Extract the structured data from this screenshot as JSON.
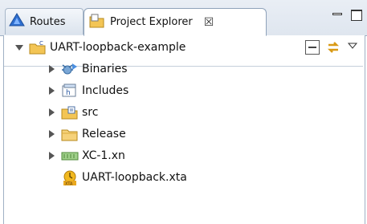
{
  "tabs": [
    {
      "label": "Routes"
    },
    {
      "label": "Project Explorer",
      "close": "☒"
    }
  ],
  "tree": {
    "root": {
      "label": "UART-loopback-example",
      "expanded": true
    },
    "children": [
      {
        "label": "Binaries",
        "icon": "binaries-icon",
        "expandable": true
      },
      {
        "label": "Includes",
        "icon": "includes-icon",
        "expandable": true
      },
      {
        "label": "src",
        "icon": "source-folder-icon",
        "expandable": true
      },
      {
        "label": "Release",
        "icon": "folder-icon",
        "expandable": true
      },
      {
        "label": "XC-1.xn",
        "icon": "xn-file-icon",
        "expandable": true
      },
      {
        "label": "UART-loopback.xta",
        "icon": "xta-file-icon",
        "expandable": false
      }
    ]
  },
  "colors": {
    "accent": "#3a6fc4",
    "folder": "#e6b43a",
    "tab_border": "#8fa2ba"
  }
}
